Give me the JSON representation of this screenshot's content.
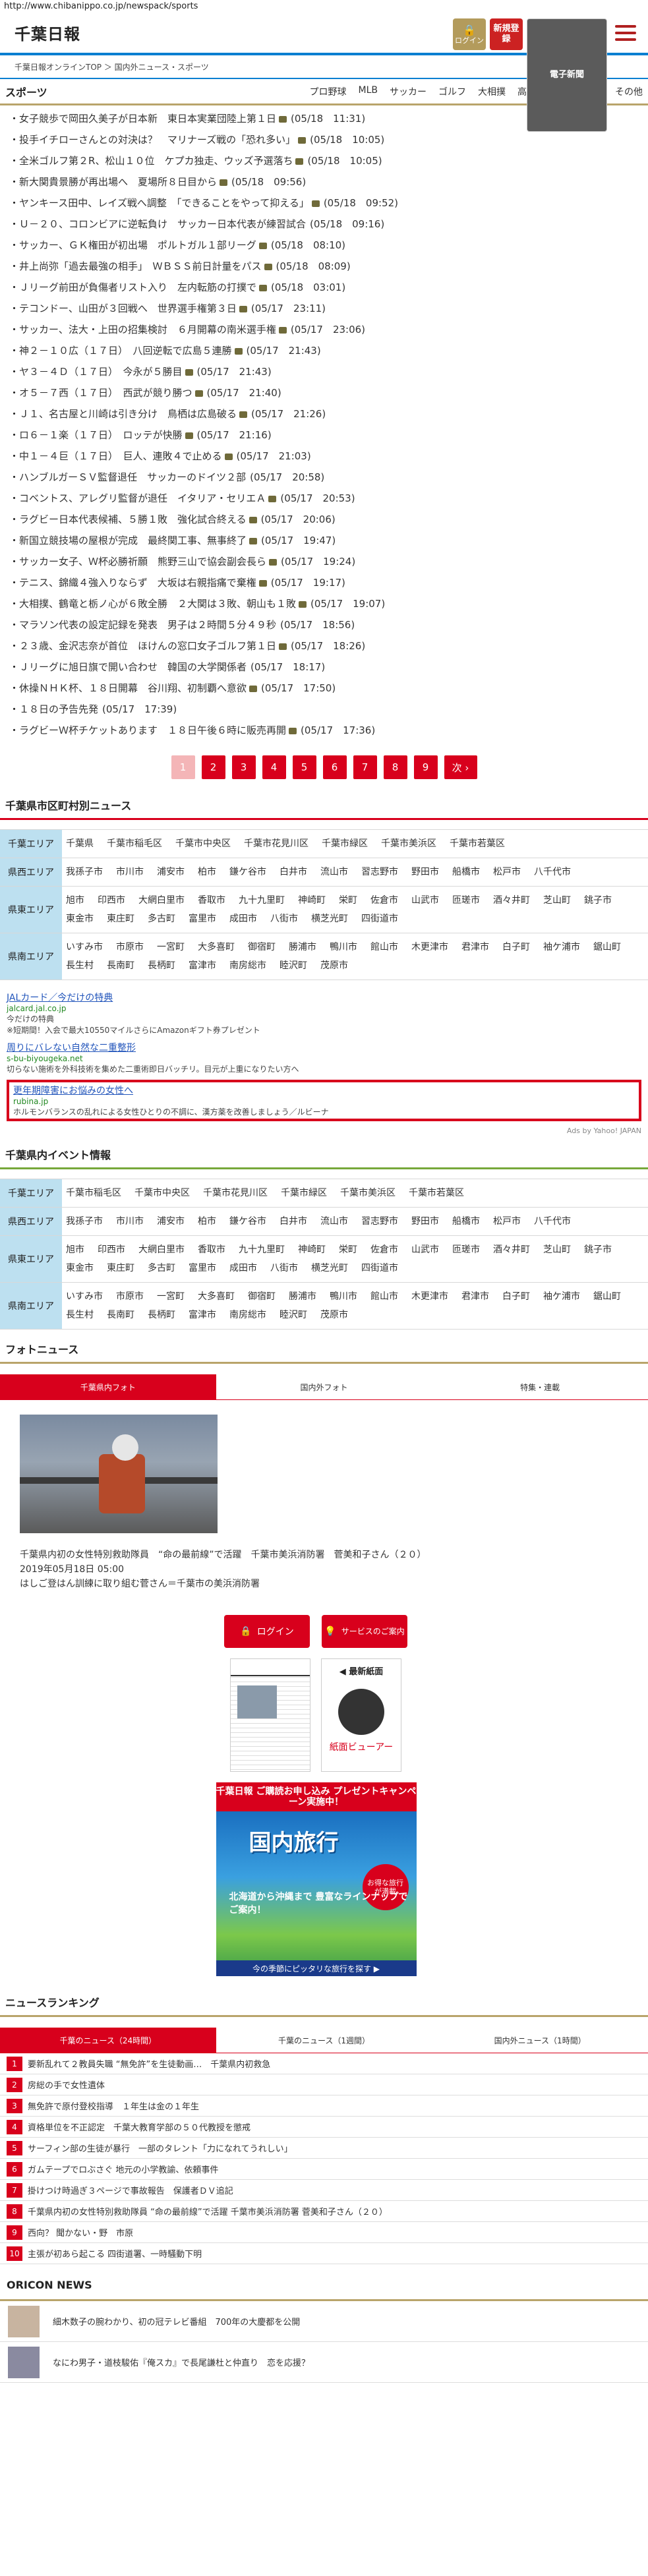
{
  "url": "http://www.chibanippo.co.jp/newspack/sports",
  "header": {
    "logo": "千葉日報",
    "logo_sub": "千葉日報オンラインTOP ＞ 国内外ニュース・スポーツ",
    "login_label": "ログイン",
    "register_label": "新規登録",
    "epaper_label": "電子新聞"
  },
  "sports": {
    "title": "スポーツ",
    "nav": [
      "プロ野球",
      "MLB",
      "サッカー",
      "ゴルフ",
      "大相撲",
      "高校野球",
      "国際大会",
      "その他"
    ],
    "items": [
      {
        "t": "女子競歩で岡田久美子が日本新　東日本実業団陸上第１日",
        "d": "(05/18　11:31)",
        "cam": true
      },
      {
        "t": "投手イチローさんとの対決は？　マリナーズ戦の「恐れ多い」",
        "d": "(05/18　10:05)",
        "cam": true
      },
      {
        "t": "全米ゴルフ第２R、松山１０位　ケプカ独走、ウッズ予選落ち",
        "d": "(05/18　10:05)",
        "cam": true
      },
      {
        "t": "新大関貴景勝が再出場へ　夏場所８日目から",
        "d": "(05/18　09:56)",
        "cam": true
      },
      {
        "t": "ヤンキース田中、レイズ戦へ調整　「できることをやって抑える」",
        "d": "(05/18　09:52)",
        "cam": true
      },
      {
        "t": "Ｕ－２０、コロンビアに逆転負け　サッカー日本代表が練習試合",
        "d": "(05/18　09:16)",
        "cam": false
      },
      {
        "t": "サッカー、ＧＫ権田が初出場　ポルトガル１部リーグ",
        "d": "(05/18　08:10)",
        "cam": true
      },
      {
        "t": "井上尚弥「過去最強の相手」　ＷＢＳＳ前日計量をパス",
        "d": "(05/18　08:09)",
        "cam": true
      },
      {
        "t": "Ｊリーグ前田が負傷者リスト入り　左内転筋の打撲で",
        "d": "(05/18　03:01)",
        "cam": true
      },
      {
        "t": "テコンドー、山田が３回戦へ　世界選手権第３日",
        "d": "(05/17　23:11)",
        "cam": true
      },
      {
        "t": "サッカー、法大・上田の招集検討　６月開幕の南米選手権",
        "d": "(05/17　23:06)",
        "cam": true
      },
      {
        "t": "神２－１０広（１７日）　八回逆転で広島５連勝",
        "d": "(05/17　21:43)",
        "cam": true
      },
      {
        "t": "ヤ３－４Ｄ（１７日）　今永が５勝目",
        "d": "(05/17　21:43)",
        "cam": true
      },
      {
        "t": "オ５－７西（１７日）　西武が競り勝つ",
        "d": "(05/17　21:40)",
        "cam": true
      },
      {
        "t": "Ｊ１、名古屋と川崎は引き分け　鳥栖は広島破る",
        "d": "(05/17　21:26)",
        "cam": true
      },
      {
        "t": "ロ６－１楽（１７日）　ロッテが快勝",
        "d": "(05/17　21:16)",
        "cam": true
      },
      {
        "t": "中１－４巨（１７日）　巨人、連敗４で止める",
        "d": "(05/17　21:03)",
        "cam": true
      },
      {
        "t": "ハンブルガーＳＶ監督退任　サッカーのドイツ２部",
        "d": "(05/17　20:58)",
        "cam": false
      },
      {
        "t": "コベントス、アレグリ監督が退任　イタリア・セリエＡ",
        "d": "(05/17　20:53)",
        "cam": true
      },
      {
        "t": "ラグビー日本代表候補、５勝１敗　強化試合終える",
        "d": "(05/17　20:06)",
        "cam": true
      },
      {
        "t": "新国立競技場の屋根が完成　最終関工事、無事終了",
        "d": "(05/17　19:47)",
        "cam": true
      },
      {
        "t": "サッカー女子、Ｗ杯必勝祈願　熊野三山で協会副会長ら",
        "d": "(05/17　19:24)",
        "cam": true
      },
      {
        "t": "テニス、錦織４強入りならず　大坂は右親指痛で棄権",
        "d": "(05/17　19:17)",
        "cam": true
      },
      {
        "t": "大相撲、鶴竜と栃ノ心が６敗全勝　２大関は３敗、朝山も１敗",
        "d": "(05/17　19:07)",
        "cam": true
      },
      {
        "t": "マラソン代表の設定記録を発表　男子は２時間５分４９秒",
        "d": "(05/17　18:56)",
        "cam": false
      },
      {
        "t": "２３歳、金沢志奈が首位　ほけんの窓口女子ゴルフ第１日",
        "d": "(05/17　18:26)",
        "cam": true
      },
      {
        "t": "Ｊリーグに旭日旗で開い合わせ　韓国の大学関係者",
        "d": "(05/17　18:17)",
        "cam": false
      },
      {
        "t": "休操ＮＨＫ杯、１８日開幕　谷川翔、初制覇へ意欲",
        "d": "(05/17　17:50)",
        "cam": true
      },
      {
        "t": "１８日の予告先発",
        "d": "(05/17　17:39)",
        "cam": false
      },
      {
        "t": "ラグビーＷ杯チケットあります　１８日午後６時に販売再開",
        "d": "(05/17　17:36)",
        "cam": true
      }
    ],
    "pages": [
      "1",
      "2",
      "3",
      "4",
      "5",
      "6",
      "7",
      "8",
      "9",
      "次 ›"
    ]
  },
  "city_news": {
    "title": "千葉県市区町村別ニュース",
    "rows": [
      {
        "label": "千葉エリア",
        "cities": [
          "千葉県",
          "千葉市稲毛区",
          "千葉市中央区",
          "千葉市花見川区",
          "千葉市緑区",
          "千葉市美浜区",
          "千葉市若葉区"
        ]
      },
      {
        "label": "県西エリア",
        "cities": [
          "我孫子市",
          "市川市",
          "浦安市",
          "柏市",
          "鎌ケ谷市",
          "白井市",
          "流山市",
          "習志野市",
          "野田市",
          "船橋市",
          "松戸市",
          "八千代市"
        ]
      },
      {
        "label": "県東エリア",
        "cities": [
          "旭市",
          "印西市",
          "大網白里市",
          "香取市",
          "九十九里町",
          "神崎町",
          "栄町",
          "佐倉市",
          "山武市",
          "匝瑳市",
          "酒々井町",
          "芝山町",
          "銚子市",
          "東金市",
          "東庄町",
          "多古町",
          "富里市",
          "成田市",
          "八街市",
          "横芝光町",
          "四街道市"
        ]
      },
      {
        "label": "県南エリア",
        "cities": [
          "いすみ市",
          "市原市",
          "一宮町",
          "大多喜町",
          "御宿町",
          "勝浦市",
          "鴨川市",
          "館山市",
          "木更津市",
          "君津市",
          "白子町",
          "袖ケ浦市",
          "鋸山町",
          "長生村",
          "長南町",
          "長柄町",
          "富津市",
          "南房総市",
          "睦沢町",
          "茂原市"
        ]
      }
    ]
  },
  "ads": {
    "items": [
      {
        "title": "JALカード／今だけの特典",
        "url": "jalcard.jal.co.jp",
        "desc": "今だけの特典",
        "sub": "※短期間！入会で最大10550マイルさらにAmazonギフト券プレゼント"
      },
      {
        "title": "周りにバレない自然な二重整形",
        "url": "s-bu-biyougeka.net",
        "desc": "切らない施術を外科技術を集めた二重術即日バッチリ。目元が上重になりたい方へ"
      },
      {
        "title": "更年期障害にお悩みの女性へ",
        "url": "rubina.jp",
        "desc": "ホルモンバランスの乱れによる女性ひとりの不調に、漢方薬を改善しましょう／ルビーナ"
      }
    ],
    "by": "Ads by Yahoo! JAPAN"
  },
  "events": {
    "title": "千葉県内イベント情報",
    "rows": [
      {
        "label": "千葉エリア",
        "cities": [
          "千葉市稲毛区",
          "千葉市中央区",
          "千葉市花見川区",
          "千葉市緑区",
          "千葉市美浜区",
          "千葉市若葉区"
        ]
      },
      {
        "label": "県西エリア",
        "cities": [
          "我孫子市",
          "市川市",
          "浦安市",
          "柏市",
          "鎌ケ谷市",
          "白井市",
          "流山市",
          "習志野市",
          "野田市",
          "船橋市",
          "松戸市",
          "八千代市"
        ]
      },
      {
        "label": "県東エリア",
        "cities": [
          "旭市",
          "印西市",
          "大網白里市",
          "香取市",
          "九十九里町",
          "神崎町",
          "栄町",
          "佐倉市",
          "山武市",
          "匝瑳市",
          "酒々井町",
          "芝山町",
          "銚子市",
          "東金市",
          "東庄町",
          "多古町",
          "富里市",
          "成田市",
          "八街市",
          "横芝光町",
          "四街道市"
        ]
      },
      {
        "label": "県南エリア",
        "cities": [
          "いすみ市",
          "市原市",
          "一宮町",
          "大多喜町",
          "御宿町",
          "勝浦市",
          "鴨川市",
          "館山市",
          "木更津市",
          "君津市",
          "白子町",
          "袖ケ浦市",
          "鋸山町",
          "長生村",
          "長南町",
          "長柄町",
          "富津市",
          "南房総市",
          "睦沢町",
          "茂原市"
        ]
      }
    ]
  },
  "photo_news": {
    "title": "フォトニュース",
    "tabs": [
      "千葉県内フォト",
      "国内外フォト",
      "特集・連載"
    ],
    "caption": "千葉県内初の女性特別救助隊員　“命の最前線”で活躍　千葉市美浜消防署　菅美和子さん（２０）",
    "date": "2019年05月18日 05:00",
    "sub": "はしご登はん訓練に取り組む菅さん＝千葉市の美浜消防署"
  },
  "side": {
    "login": "ログイン",
    "service": "サービスのご案内",
    "newest": "◀ 最新紙面",
    "viewer": "紙面ビューアー",
    "banner_top": "千葉日報 ご購読お申し込み プレゼントキャンペーン実施中！",
    "banner_big": "国内旅行",
    "banner_circle": "お得な旅行が満載",
    "banner_text": "北海道から沖縄まで 豊富なラインナップでご案内！",
    "banner_foot": "今の季節にピッタリな旅行を探す ▶"
  },
  "ranking": {
    "title": "ニュースランキング",
    "tabs": [
      "千葉のニュース（24時間）",
      "千葉のニュース（1週間）",
      "国内外ニュース（1時間）"
    ],
    "items": [
      "要新乱れて２教員失職 “無免許”を生徒動画…　千葉県内初救急",
      "房総の手で女性遺体",
      "無免許で原付登校指導　１年生は金の１年生",
      "資格単位を不正認定　千葉大教育学部の５０代教授を懲戒",
      "サーフィン部の生徒が暴行　一部のタレント「力になれてうれしい」",
      "ガムテープでロぶさぐ 地元の小学教諭、依頼事件",
      "掛けつけ時過ぎ３ページで事故報告　保護者ＤＶ追記",
      "千葉県内初の女性特別救助隊員 “命の最前線”で活躍 千葉市美浜消防署 菅美和子さん（２０）",
      "西向？ 聞かない・野　市原",
      "主張が初あら起こる 四街道署、一時騒動下明"
    ]
  },
  "oricon": {
    "title": "ORICON NEWS",
    "items": [
      "細木数子の腕わかり、初の冠テレビ番組　700年の大慶都を公開",
      "なにわ男子・道枝駿佑『俺スカ』で長尾謙杜と仲直り　恋を応援？"
    ]
  }
}
